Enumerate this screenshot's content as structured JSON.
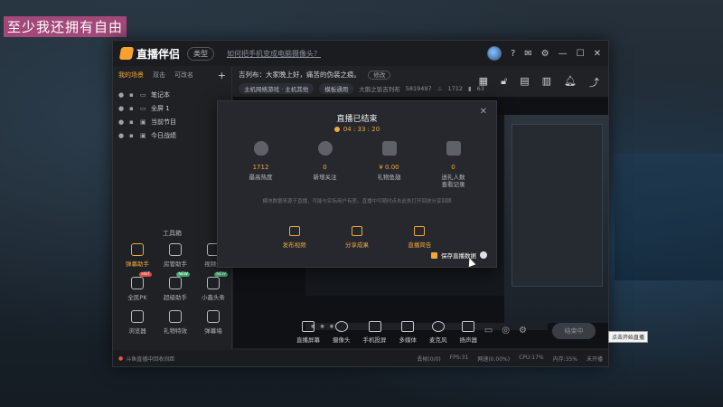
{
  "overlay_caption": "至少我还拥有自由",
  "app": {
    "name": "直播伴侣",
    "type_label": "类型",
    "title_link": "如何把手机变成电脑摄像头？",
    "window_controls": [
      "help-icon",
      "message-icon",
      "settings-icon",
      "minimize-icon",
      "maximize-icon",
      "close-icon"
    ]
  },
  "left": {
    "tabs": [
      "我的场景",
      "双击",
      "可改名"
    ],
    "add": "+",
    "scenes": [
      {
        "label": "笔记本"
      },
      {
        "label": "全屏 1"
      },
      {
        "label": "当前节目"
      },
      {
        "label": "今日战绩"
      }
    ],
    "tools_title": "工具箱",
    "tools": [
      {
        "label": "弹幕助手",
        "active": true,
        "badge": ""
      },
      {
        "label": "房管助手",
        "active": false,
        "badge": ""
      },
      {
        "label": "视频连",
        "active": false,
        "badge": ""
      },
      {
        "label": "全民PK",
        "active": false,
        "badge": "HOT"
      },
      {
        "label": "超级助手",
        "active": false,
        "badge": "NEW"
      },
      {
        "label": "小鑫头条",
        "active": false,
        "badge": "NEW"
      },
      {
        "label": "浏览器",
        "active": false,
        "badge": ""
      },
      {
        "label": "礼物特效",
        "active": false,
        "badge": ""
      },
      {
        "label": "弹幕墙",
        "active": false,
        "badge": ""
      }
    ]
  },
  "top": {
    "announcement": "吉列布：大家晚上好，痛苦的伪装之痕。",
    "modify": "修改",
    "tag_category": "主机网络游戏 · 主机其他",
    "tag_apply": "模板通用",
    "room_info": "大鹅之饭吉列布",
    "room_id": "5819497",
    "heat": "1712",
    "count": "63"
  },
  "modal": {
    "title": "直播已结束",
    "time": "04 : 33 : 20",
    "stats": [
      {
        "value": "1712",
        "label": "最高热度"
      },
      {
        "value": "0",
        "label": "新增关注"
      },
      {
        "value": "¥ 0.00",
        "label": "礼物鱼翅"
      },
      {
        "value": "0",
        "label": "送礼人数\n查看记录"
      }
    ],
    "hint": "模块数据来源于直播，可能与实际用户有差。直播中可随时点击此处打开回放分享回顾",
    "actions": [
      "发布视频",
      "分享成果",
      "直播简告"
    ],
    "save_data": "保存直播数据"
  },
  "controls": {
    "items": [
      "直播屏幕",
      "摄像头",
      "手机投屏",
      "多媒体",
      "麦克风",
      "扬声器"
    ],
    "start_button": "结束中",
    "tooltip": "点击开始直播"
  },
  "statusbar": {
    "warning": "斗鱼直播中回收间距",
    "right": [
      "丢帧(0/0)",
      "FPS:31",
      "网速(0.00%)",
      "CPU:17%",
      "内存:35%",
      "未开播"
    ]
  }
}
